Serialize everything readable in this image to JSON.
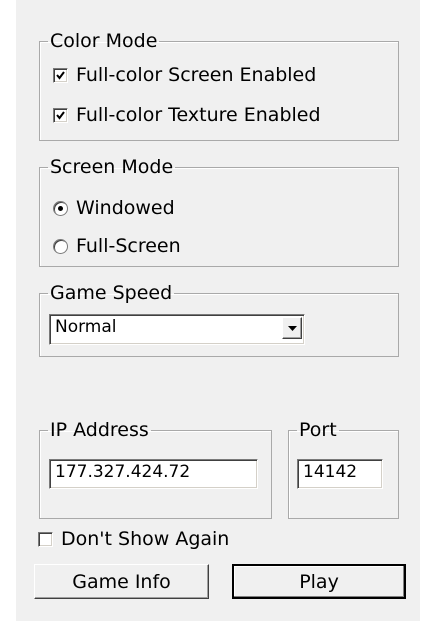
{
  "color_mode": {
    "legend": "Color Mode",
    "options": [
      {
        "label": "Full-color Screen Enabled",
        "checked": true
      },
      {
        "label": "Full-color Texture Enabled",
        "checked": true
      }
    ]
  },
  "screen_mode": {
    "legend": "Screen Mode",
    "options": [
      {
        "label": "Windowed",
        "selected": true
      },
      {
        "label": "Full-Screen",
        "selected": false
      }
    ]
  },
  "game_speed": {
    "legend": "Game Speed",
    "selected": "Normal"
  },
  "network": {
    "ip_legend": "IP Address",
    "ip_value": "177.327.424.72",
    "port_legend": "Port",
    "port_value": "14142"
  },
  "dont_show_again": {
    "label": "Don't Show Again",
    "checked": false
  },
  "buttons": {
    "game_info": "Game Info",
    "play": "Play"
  }
}
